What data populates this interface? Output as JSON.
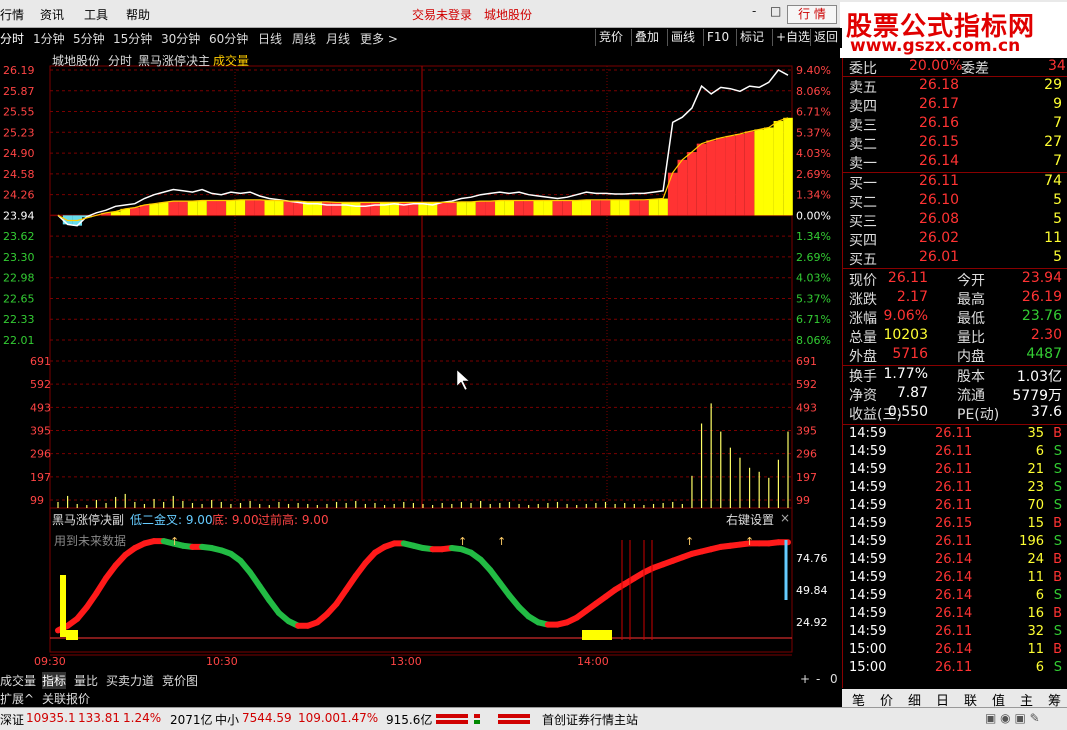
{
  "menu": {
    "app": "行情",
    "info": "资讯",
    "tools": "工具",
    "help": "帮助",
    "login_status": "交易未登录",
    "stock_name": "城地股份",
    "quote_button": "行 情",
    "win_min": "-",
    "win_restore": "□",
    "win_close": "×"
  },
  "logo": {
    "line1": "股票公式指标网",
    "line2": "www.gszx.com.cn"
  },
  "periods": [
    "分时",
    "1分钟",
    "5分钟",
    "15分钟",
    "30分钟",
    "60分钟",
    "日线",
    "周线",
    "月线",
    "更多 >"
  ],
  "toolbar_right": [
    "竞价",
    "叠加",
    "画线",
    "F10",
    "标记",
    "+自选",
    "返回"
  ],
  "chart": {
    "stock": "城地股份",
    "mode": "分时",
    "indicator": "黑马涨停决主",
    "volume_label": "成交量",
    "price_ticks": [
      "26.19",
      "25.87",
      "25.55",
      "25.23",
      "24.90",
      "24.58",
      "24.26",
      "23.94",
      "23.62",
      "23.30",
      "22.98",
      "22.65",
      "22.33",
      "22.01"
    ],
    "pct_ticks": [
      "9.40%",
      "8.06%",
      "6.71%",
      "5.37%",
      "4.03%",
      "2.69%",
      "1.34%",
      "0.00%",
      "1.34%",
      "2.69%",
      "4.03%",
      "5.37%",
      "6.71%",
      "8.06%"
    ],
    "vol_ticks": [
      "691",
      "592",
      "493",
      "395",
      "296",
      "197",
      "99"
    ],
    "sub_title": "黑马涨停决副",
    "sub_params": "低二金叉: 9.00",
    "sub_bottom": "底: 9.00",
    "sub_prev_high": "过前高: 9.00",
    "sub_settings": "右键设置",
    "sub_close": "×",
    "sub_note": "用到未来数据",
    "sub_ticks": [
      "74.76",
      "49.84",
      "24.92"
    ],
    "time_ticks": [
      "09:30",
      "10:30",
      "13:00",
      "14:00"
    ],
    "prev_close": 23.94,
    "price_series": [
      23.94,
      23.8,
      23.78,
      23.92,
      23.98,
      24.02,
      24.08,
      24.1,
      24.12,
      24.2,
      24.26,
      24.3,
      24.34,
      24.32,
      24.3,
      24.34,
      24.28,
      24.26,
      24.3,
      24.28,
      24.3,
      24.24,
      24.2,
      24.18,
      24.16,
      24.14,
      24.12,
      24.12,
      24.1,
      24.1,
      24.1,
      24.08,
      24.08,
      24.1,
      24.1,
      24.12,
      24.1,
      24.12,
      24.12,
      24.1,
      24.14,
      24.16,
      24.2,
      24.22,
      24.26,
      24.28,
      24.3,
      24.28,
      24.3,
      24.26,
      24.24,
      24.22,
      24.2,
      24.22,
      24.26,
      24.3,
      24.28,
      24.28,
      24.27,
      24.27,
      24.28,
      24.28,
      24.3,
      24.32,
      25.38,
      25.46,
      25.6,
      25.94,
      25.82,
      25.92,
      25.9,
      25.86,
      25.94,
      25.92,
      26.0,
      26.19,
      26.11
    ],
    "avg_series": [
      23.94,
      23.86,
      23.86,
      23.9,
      23.94,
      23.98,
      24.0,
      24.04,
      24.06,
      24.1,
      24.12,
      24.14,
      24.16,
      24.16,
      24.16,
      24.17,
      24.17,
      24.17,
      24.17,
      24.18,
      24.18,
      24.18,
      24.17,
      24.17,
      24.16,
      24.16,
      24.15,
      24.15,
      24.15,
      24.14,
      24.14,
      24.14,
      24.14,
      24.14,
      24.14,
      24.14,
      24.14,
      24.14,
      24.14,
      24.14,
      24.14,
      24.14,
      24.15,
      24.15,
      24.16,
      24.16,
      24.17,
      24.17,
      24.17,
      24.17,
      24.17,
      24.17,
      24.17,
      24.17,
      24.17,
      24.18,
      24.18,
      24.18,
      24.18,
      24.18,
      24.18,
      24.18,
      24.19,
      24.2,
      24.6,
      24.8,
      24.92,
      25.05,
      25.1,
      25.14,
      25.17,
      25.2,
      25.24,
      25.27,
      25.3,
      25.4,
      25.45
    ],
    "volume_series": [
      30,
      60,
      20,
      15,
      40,
      25,
      55,
      70,
      30,
      20,
      45,
      30,
      60,
      35,
      25,
      20,
      40,
      30,
      20,
      25,
      35,
      20,
      15,
      30,
      20,
      25,
      20,
      15,
      20,
      30,
      25,
      35,
      20,
      25,
      15,
      20,
      30,
      25,
      20,
      15,
      25,
      20,
      30,
      25,
      35,
      20,
      25,
      30,
      20,
      15,
      20,
      25,
      30,
      20,
      15,
      20,
      25,
      30,
      20,
      25,
      20,
      15,
      20,
      25,
      30,
      20,
      160,
      420,
      520,
      380,
      300,
      250,
      200,
      180,
      150,
      240,
      380
    ],
    "osc_series": [
      10,
      14,
      20,
      30,
      42,
      55,
      66,
      75,
      81,
      85,
      87,
      87,
      85,
      83,
      82,
      82,
      81,
      79,
      76,
      70,
      60,
      48,
      36,
      25,
      18,
      14,
      14,
      17,
      24,
      33,
      45,
      57,
      68,
      77,
      82,
      85,
      85,
      83,
      81,
      80,
      80,
      81,
      80,
      77,
      71,
      62,
      51,
      40,
      30,
      22,
      17,
      15,
      15,
      17,
      21,
      27,
      33,
      39,
      45,
      50,
      55,
      60,
      64,
      67,
      70,
      73,
      76,
      78,
      80,
      82,
      83,
      84,
      85,
      85,
      85,
      86,
      86
    ]
  },
  "bottom_tabs": [
    "成交量",
    "指标",
    "量比",
    "买卖力道",
    "竞价图"
  ],
  "bottom_tab_active": "指标",
  "ext_tabs": [
    "扩展^",
    "关联报价"
  ],
  "status": {
    "sz_label": "深证",
    "sz_index": "10935.1",
    "sz_change": "133.81",
    "sz_pct": "1.24%",
    "sz_amount": "2071亿",
    "zx_label": "中小",
    "zx_index": "7544.59",
    "zx_change": "109.00",
    "zx_pct": "1.47%",
    "zx_amount": "915.6亿",
    "server": "首创证券行情主站"
  },
  "panel": {
    "weibi_label": "委比",
    "weibi_value": "20.00%",
    "weicha_label": "委差",
    "weicha_value": "34",
    "sells": [
      {
        "label": "卖五",
        "price": "26.18",
        "vol": "29"
      },
      {
        "label": "卖四",
        "price": "26.17",
        "vol": "9"
      },
      {
        "label": "卖三",
        "price": "26.16",
        "vol": "7"
      },
      {
        "label": "卖二",
        "price": "26.15",
        "vol": "27"
      },
      {
        "label": "卖一",
        "price": "26.14",
        "vol": "7"
      }
    ],
    "buys": [
      {
        "label": "买一",
        "price": "26.11",
        "vol": "74"
      },
      {
        "label": "买二",
        "price": "26.10",
        "vol": "5"
      },
      {
        "label": "买三",
        "price": "26.08",
        "vol": "5"
      },
      {
        "label": "买四",
        "price": "26.02",
        "vol": "11"
      },
      {
        "label": "买五",
        "price": "26.01",
        "vol": "5"
      }
    ],
    "stats": [
      {
        "l1": "现价",
        "v1": "26.11",
        "l2": "今开",
        "v2": "23.94"
      },
      {
        "l1": "涨跌",
        "v1": "2.17",
        "l2": "最高",
        "v2": "26.19"
      },
      {
        "l1": "涨幅",
        "v1": "9.06%",
        "l2": "最低",
        "v2": "23.76"
      },
      {
        "l1": "总量",
        "v1": "10203",
        "l2": "量比",
        "v2": "2.30"
      },
      {
        "l1": "外盘",
        "v1": "5716",
        "l2": "内盘",
        "v2": "4487"
      }
    ],
    "stats2": [
      {
        "l1": "换手",
        "v1": "1.77%",
        "l2": "股本",
        "v2": "1.03亿"
      },
      {
        "l1": "净资",
        "v1": "7.87",
        "l2": "流通",
        "v2": "5779万"
      },
      {
        "l1": "收益(三)",
        "v1": "0.550",
        "l2": "PE(动)",
        "v2": "37.6"
      }
    ],
    "ticks": [
      {
        "t": "14:59",
        "p": "26.11",
        "v": "35",
        "d": "B"
      },
      {
        "t": "14:59",
        "p": "26.11",
        "v": "6",
        "d": "S"
      },
      {
        "t": "14:59",
        "p": "26.11",
        "v": "21",
        "d": "S"
      },
      {
        "t": "14:59",
        "p": "26.11",
        "v": "23",
        "d": "S"
      },
      {
        "t": "14:59",
        "p": "26.11",
        "v": "70",
        "d": "S"
      },
      {
        "t": "14:59",
        "p": "26.15",
        "v": "15",
        "d": "B"
      },
      {
        "t": "14:59",
        "p": "26.11",
        "v": "196",
        "d": "S"
      },
      {
        "t": "14:59",
        "p": "26.14",
        "v": "24",
        "d": "B"
      },
      {
        "t": "14:59",
        "p": "26.14",
        "v": "11",
        "d": "B"
      },
      {
        "t": "14:59",
        "p": "26.14",
        "v": "6",
        "d": "S"
      },
      {
        "t": "14:59",
        "p": "26.14",
        "v": "16",
        "d": "B"
      },
      {
        "t": "14:59",
        "p": "26.11",
        "v": "32",
        "d": "S"
      },
      {
        "t": "15:00",
        "p": "26.14",
        "v": "11",
        "d": "B"
      },
      {
        "t": "15:00",
        "p": "26.11",
        "v": "6",
        "d": "S"
      }
    ],
    "tabs": [
      "笔",
      "价",
      "细",
      "日",
      "联",
      "值",
      "主",
      "筹"
    ]
  },
  "colors": {
    "up": "#ff3333",
    "down": "#33cc33",
    "yellow": "#ffff00",
    "grid": "#7a0000",
    "axis_red": "#ff4444",
    "white": "#ffffff"
  }
}
